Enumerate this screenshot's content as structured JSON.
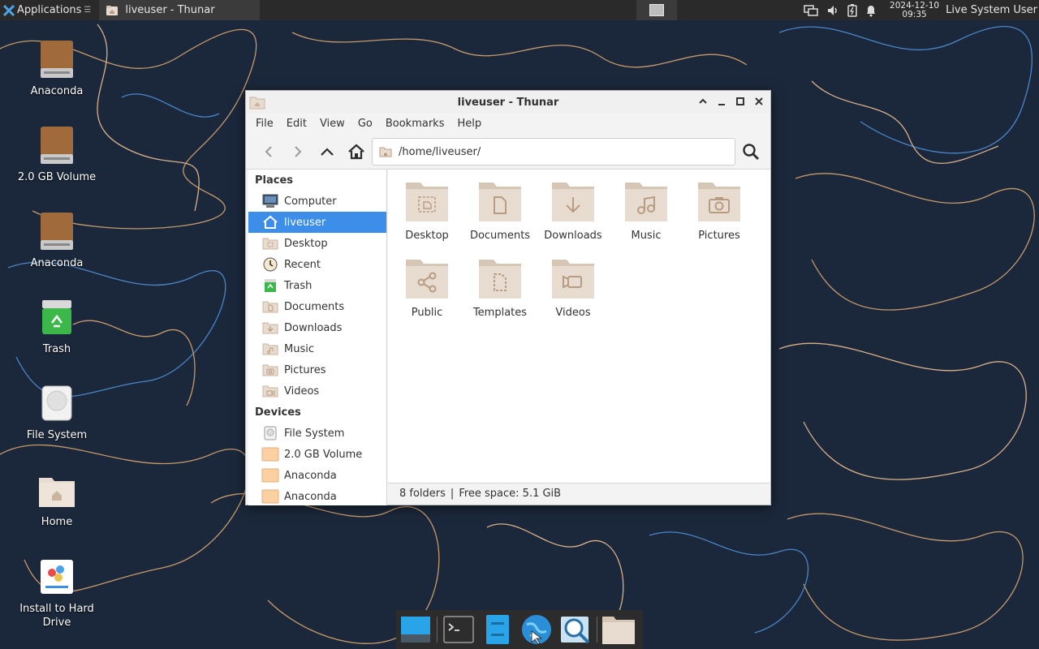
{
  "top_panel": {
    "applications_label": "Applications",
    "task_title": "liveuser - Thunar",
    "clock_date": "2024-12-10",
    "clock_time": "09:35",
    "user_name": "Live System User",
    "tray_icons": [
      "network-icon",
      "volume-icon",
      "battery-icon",
      "notification-bell-icon"
    ]
  },
  "desktop_icons": [
    {
      "label": "Anaconda",
      "icon": "drive-icon"
    },
    {
      "label": "2.0 GB Volume",
      "icon": "drive-icon"
    },
    {
      "label": "Anaconda",
      "icon": "drive-icon"
    },
    {
      "label": "Trash",
      "icon": "trash-icon"
    },
    {
      "label": "File System",
      "icon": "filesystem-icon"
    },
    {
      "label": "Home",
      "icon": "home-folder-icon"
    },
    {
      "label": "Install to Hard Drive",
      "icon": "installer-icon"
    }
  ],
  "window": {
    "title": "liveuser - Thunar",
    "menu": [
      "File",
      "Edit",
      "View",
      "Go",
      "Bookmarks",
      "Help"
    ],
    "location_path": "/home/liveuser/",
    "sidebar": {
      "places_header": "Places",
      "places": [
        {
          "label": "Computer",
          "icon": "computer-icon"
        },
        {
          "label": "liveuser",
          "icon": "home-icon",
          "active": true
        },
        {
          "label": "Desktop",
          "icon": "desktop-folder-icon"
        },
        {
          "label": "Recent",
          "icon": "clock-icon"
        },
        {
          "label": "Trash",
          "icon": "trash-icon"
        },
        {
          "label": "Documents",
          "icon": "documents-folder-icon"
        },
        {
          "label": "Downloads",
          "icon": "downloads-folder-icon"
        },
        {
          "label": "Music",
          "icon": "music-folder-icon"
        },
        {
          "label": "Pictures",
          "icon": "pictures-folder-icon"
        },
        {
          "label": "Videos",
          "icon": "videos-folder-icon"
        }
      ],
      "devices_header": "Devices",
      "devices": [
        {
          "label": "File System",
          "icon": "filesystem-icon"
        },
        {
          "label": "2.0 GB Volume",
          "icon": "drive-icon"
        },
        {
          "label": "Anaconda",
          "icon": "drive-icon"
        },
        {
          "label": "Anaconda",
          "icon": "drive-icon"
        }
      ]
    },
    "folders": [
      {
        "label": "Desktop",
        "emblem": "desktop"
      },
      {
        "label": "Documents",
        "emblem": "document"
      },
      {
        "label": "Downloads",
        "emblem": "download"
      },
      {
        "label": "Music",
        "emblem": "music"
      },
      {
        "label": "Pictures",
        "emblem": "camera"
      },
      {
        "label": "Public",
        "emblem": "share"
      },
      {
        "label": "Templates",
        "emblem": "template"
      },
      {
        "label": "Videos",
        "emblem": "video"
      }
    ],
    "status_folders": "8 folders",
    "status_separator": "|",
    "status_free": "Free space: 5.1 GiB"
  },
  "dock": [
    "show-desktop-icon",
    "terminal-icon",
    "file-manager-icon",
    "web-browser-icon",
    "app-finder-icon",
    "folder-icon"
  ],
  "colors": {
    "panel": "#2a2a2a",
    "selection": "#3d8ee8",
    "folder": "#e8dcd0",
    "folder_dark": "#d6c6b6",
    "drive": "#a06a3a"
  }
}
